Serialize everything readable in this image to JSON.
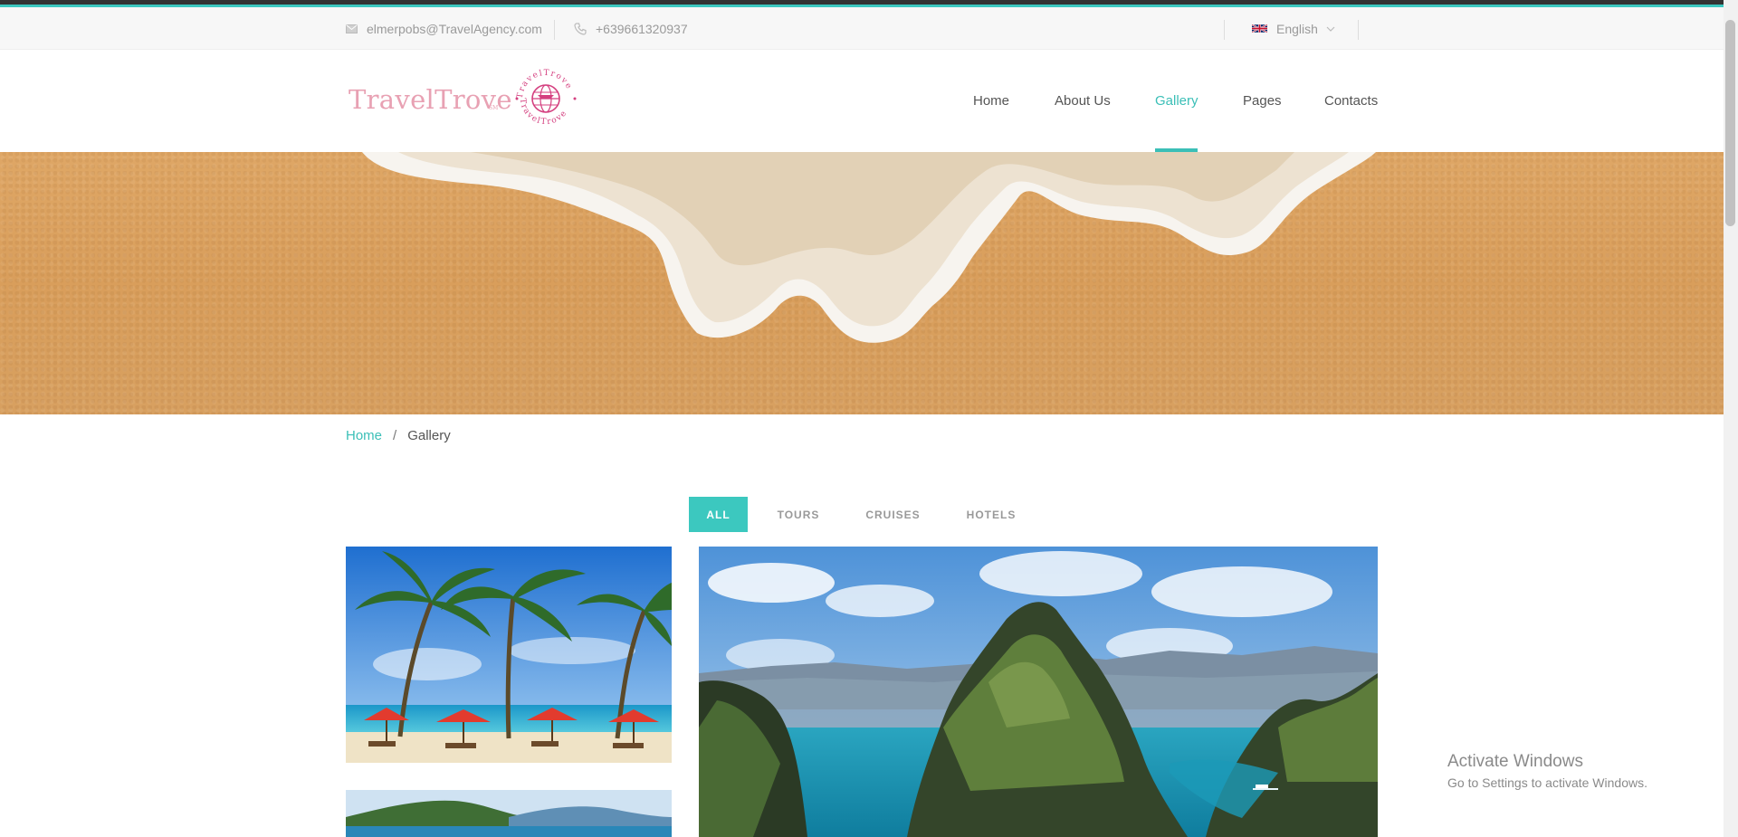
{
  "topbar": {
    "email": "elmerpobs@TravelAgency.com",
    "phone": "+639661320937",
    "language": "English"
  },
  "header": {
    "logo_text": "TravelTrove",
    "logo_sm": "SM",
    "seal_text": "TravelTrove",
    "nav": [
      "Home",
      "About Us",
      "Gallery",
      "Pages",
      "Contacts"
    ],
    "active_nav": "Gallery"
  },
  "breadcrumb": {
    "home": "Home",
    "separator": "/",
    "current": "Gallery"
  },
  "filters": [
    "ALL",
    "TOURS",
    "CRUISES",
    "HOTELS"
  ],
  "active_filter": "ALL",
  "windows_notice": {
    "title": "Activate Windows",
    "subtitle": "Go to Settings to activate Windows."
  },
  "colors": {
    "accent": "#3cc8bf",
    "logo": "#e8a1b3",
    "seal": "#d43f7f"
  }
}
